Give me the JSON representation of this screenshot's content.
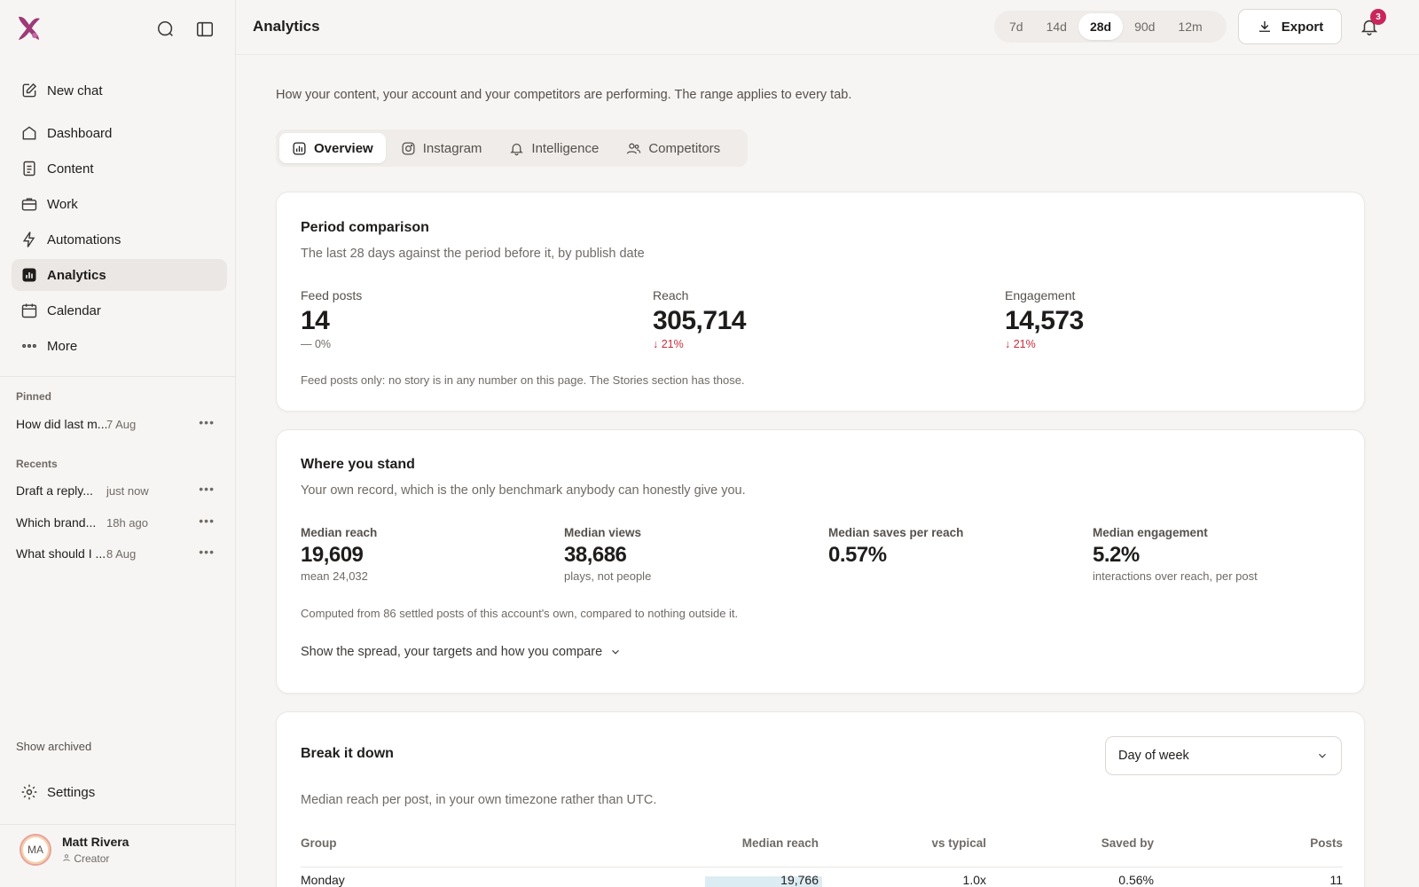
{
  "sidebar": {
    "nav": [
      {
        "label": "New chat",
        "icon": "edit-icon"
      },
      {
        "label": "Dashboard",
        "icon": "home-icon"
      },
      {
        "label": "Content",
        "icon": "document-icon"
      },
      {
        "label": "Work",
        "icon": "briefcase-icon"
      },
      {
        "label": "Automations",
        "icon": "bolt-icon"
      },
      {
        "label": "Analytics",
        "icon": "analytics-icon",
        "active": true
      },
      {
        "label": "Calendar",
        "icon": "calendar-icon"
      },
      {
        "label": "More",
        "icon": "more-icon"
      }
    ],
    "pinned_label": "Pinned",
    "pinned": [
      {
        "title": "How did last m...",
        "date": "7 Aug"
      }
    ],
    "recents_label": "Recents",
    "recents": [
      {
        "title": "Draft a reply...",
        "date": "just now"
      },
      {
        "title": "Which brand...",
        "date": "18h ago"
      },
      {
        "title": "What should I ...",
        "date": "8 Aug"
      }
    ],
    "show_archived": "Show archived",
    "settings": "Settings",
    "user": {
      "initials": "MA",
      "name": "Matt Rivera",
      "role": "Creator"
    }
  },
  "header": {
    "title": "Analytics",
    "ranges": [
      "7d",
      "14d",
      "28d",
      "90d",
      "12m"
    ],
    "active_range": "28d",
    "export_label": "Export",
    "notifications": "3"
  },
  "main": {
    "intro": "How your content, your account and your competitors are performing. The range applies to every tab.",
    "tabs": [
      {
        "label": "Overview",
        "icon": "bar-chart-icon",
        "active": true
      },
      {
        "label": "Instagram",
        "icon": "instagram-icon"
      },
      {
        "label": "Intelligence",
        "icon": "bell-icon"
      },
      {
        "label": "Competitors",
        "icon": "users-icon"
      }
    ],
    "period": {
      "title": "Period comparison",
      "subtitle": "The last 28 days against the period before it, by publish date",
      "stats": [
        {
          "label": "Feed posts",
          "value": "14",
          "delta": "— 0%"
        },
        {
          "label": "Reach",
          "value": "305,714",
          "delta": "↓ 21%"
        },
        {
          "label": "Engagement",
          "value": "14,573",
          "delta": "↓ 21%"
        }
      ],
      "footnote": "Feed posts only: no story is in any number on this page. The Stories section has those."
    },
    "stand": {
      "title": "Where you stand",
      "subtitle": "Your own record, which is the only benchmark anybody can honestly give you.",
      "stats": [
        {
          "label": "Median reach",
          "value": "19,609",
          "note": "mean 24,032"
        },
        {
          "label": "Median views",
          "value": "38,686",
          "note": "plays, not people"
        },
        {
          "label": "Median saves per reach",
          "value": "0.57%",
          "note": ""
        },
        {
          "label": "Median engagement",
          "value": "5.2%",
          "note": "interactions over reach, per post"
        }
      ],
      "footnote": "Computed from 86 settled posts of this account's own, compared to nothing outside it.",
      "expander": "Show the spread, your targets and how you compare"
    },
    "breakdown": {
      "title": "Break it down",
      "select_value": "Day of week",
      "subtitle": "Median reach per post, in your own timezone rather than UTC.",
      "columns": [
        "Group",
        "Median reach",
        "vs typical",
        "Saved by",
        "Posts"
      ],
      "rows": [
        {
          "group": "Monday",
          "median_reach": "19,766",
          "vs_typical": "1.0x",
          "saved_by": "0.56%",
          "posts": "11",
          "reach_fill": 0.44
        }
      ]
    }
  }
}
